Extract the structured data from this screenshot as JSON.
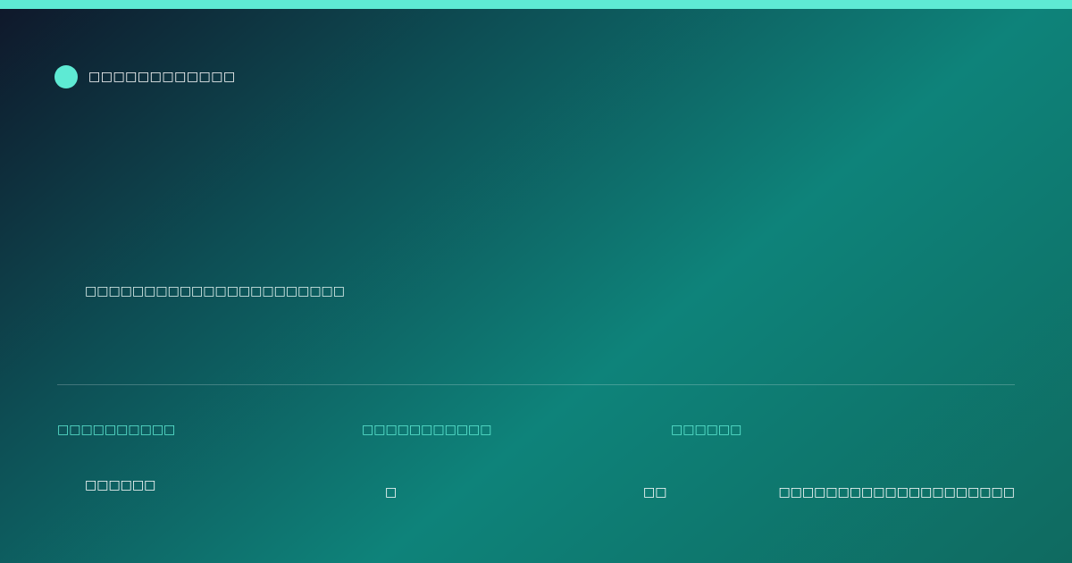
{
  "colors": {
    "accent": "#5eead4",
    "background_start": "#0f172a",
    "background_mid": "#0e837a",
    "background_end": "#0f6a60",
    "text": "#ffffff"
  },
  "header": {
    "brand_icon": "brand-dot-icon",
    "brand_name": "□□□□□□□□□□□□"
  },
  "main": {
    "headline": "□□□□□□□□□□□□□□□□□□□□□□"
  },
  "stats": [
    {
      "label": "□□□□□□□□□□",
      "value": "□□□□□□"
    },
    {
      "label": "□□□□□□□□□□□",
      "value": "□"
    },
    {
      "label": "□□□□□□",
      "value": "□□"
    }
  ],
  "footer": {
    "site": "□□□□□□□□□□□□□□□□□□□□"
  }
}
